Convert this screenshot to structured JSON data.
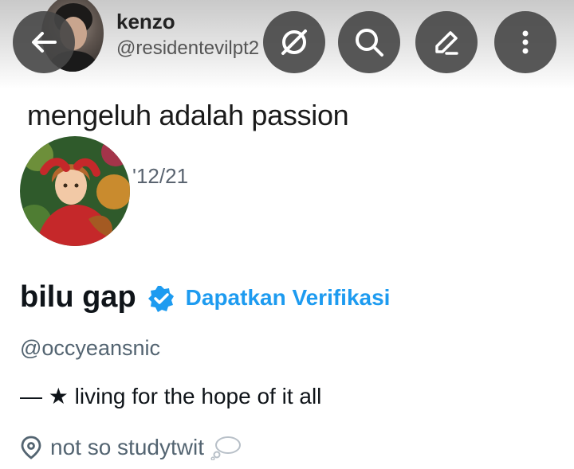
{
  "header": {
    "quoted_name": "kenzo",
    "quoted_handle": "@residentevilpt2"
  },
  "toolbar": {
    "back_icon": "arrow-left-icon",
    "grok_icon": "slashed-circle-icon",
    "search_icon": "search-icon",
    "compose_icon": "pencil-icon",
    "more_icon": "more-vertical-icon"
  },
  "pinned_tweet": {
    "text": "mengeluh adalah passion",
    "date_fragment": "'12/21"
  },
  "profile": {
    "display_name": "bilu gap",
    "verify_cta": "Dapatkan Verifikasi",
    "handle": "@occyeansnic",
    "bio": "— ★ living for the hope of it all",
    "location": "not so studytwit",
    "location_icon": "location-pin-icon",
    "location_emoji": "💭"
  },
  "colors": {
    "accent": "#1d9bf0",
    "secondary_text": "#536471",
    "button_bg": "#464646"
  }
}
